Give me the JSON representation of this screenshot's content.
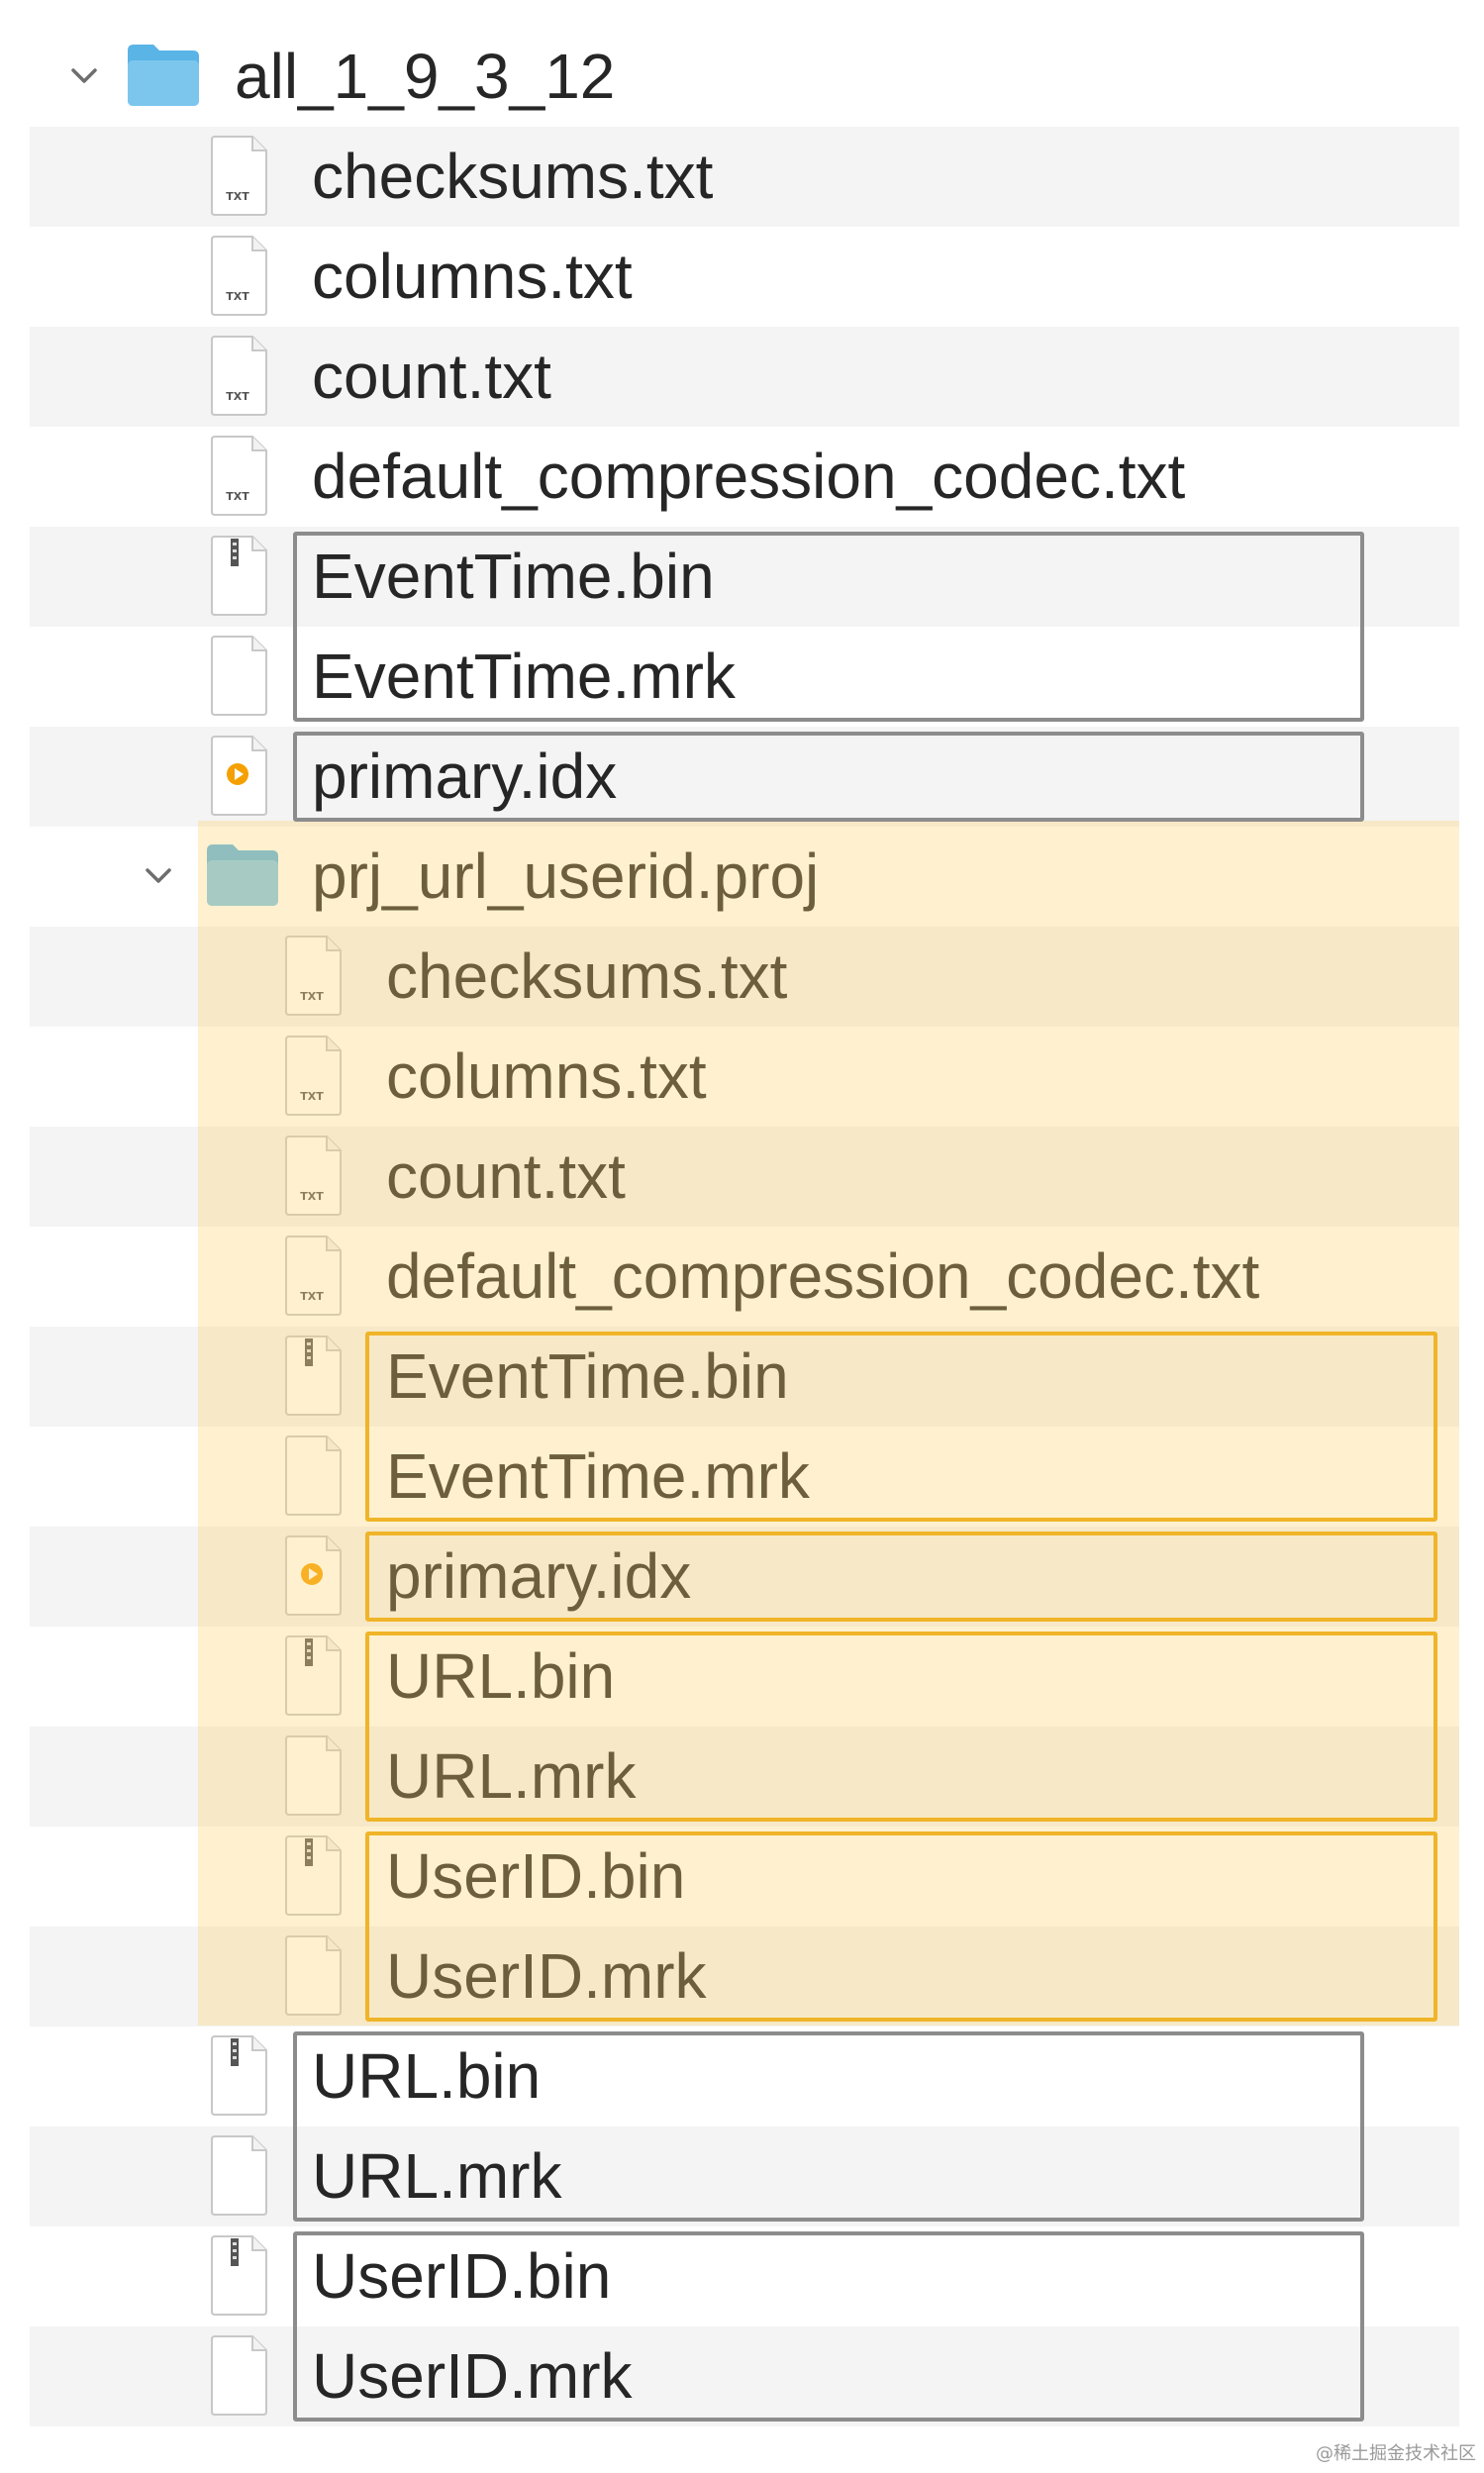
{
  "tree": {
    "rows": [
      {
        "label": "all_1_9_3_12",
        "icon": "folder-icon",
        "level": 0,
        "chevron": true
      },
      {
        "label": "checksums.txt",
        "icon": "txt-file-icon",
        "level": 1
      },
      {
        "label": "columns.txt",
        "icon": "txt-file-icon",
        "level": 1
      },
      {
        "label": "count.txt",
        "icon": "txt-file-icon",
        "level": 1
      },
      {
        "label": "default_compression_codec.txt",
        "icon": "txt-file-icon",
        "level": 1
      },
      {
        "label": "EventTime.bin",
        "icon": "archive-file-icon",
        "level": 1
      },
      {
        "label": "EventTime.mrk",
        "icon": "blank-file-icon",
        "level": 1
      },
      {
        "label": "primary.idx",
        "icon": "media-file-icon",
        "level": 1
      },
      {
        "label": "prj_url_userid.proj",
        "icon": "folder-icon",
        "level": 1,
        "chevron": true
      },
      {
        "label": "checksums.txt",
        "icon": "txt-file-icon",
        "level": 2
      },
      {
        "label": "columns.txt",
        "icon": "txt-file-icon",
        "level": 2
      },
      {
        "label": "count.txt",
        "icon": "txt-file-icon",
        "level": 2
      },
      {
        "label": "default_compression_codec.txt",
        "icon": "txt-file-icon",
        "level": 2
      },
      {
        "label": "EventTime.bin",
        "icon": "archive-file-icon",
        "level": 2
      },
      {
        "label": "EventTime.mrk",
        "icon": "blank-file-icon",
        "level": 2
      },
      {
        "label": "primary.idx",
        "icon": "media-file-icon",
        "level": 2
      },
      {
        "label": "URL.bin",
        "icon": "archive-file-icon",
        "level": 2
      },
      {
        "label": "URL.mrk",
        "icon": "blank-file-icon",
        "level": 2
      },
      {
        "label": "UserID.bin",
        "icon": "archive-file-icon",
        "level": 2
      },
      {
        "label": "UserID.mrk",
        "icon": "blank-file-icon",
        "level": 2
      },
      {
        "label": "URL.bin",
        "icon": "archive-file-icon",
        "level": 1
      },
      {
        "label": "URL.mrk",
        "icon": "blank-file-icon",
        "level": 1
      },
      {
        "label": "UserID.bin",
        "icon": "archive-file-icon",
        "level": 1
      },
      {
        "label": "UserID.mrk",
        "icon": "blank-file-icon",
        "level": 1
      }
    ]
  },
  "watermark": "@稀土掘金技术社区",
  "colors": {
    "folder": "#5ab4e6",
    "highlight": "#ffd66e",
    "gray_box": "#8c8c8c",
    "gold_box": "#f0b428",
    "media_dot": "#f5a000"
  }
}
